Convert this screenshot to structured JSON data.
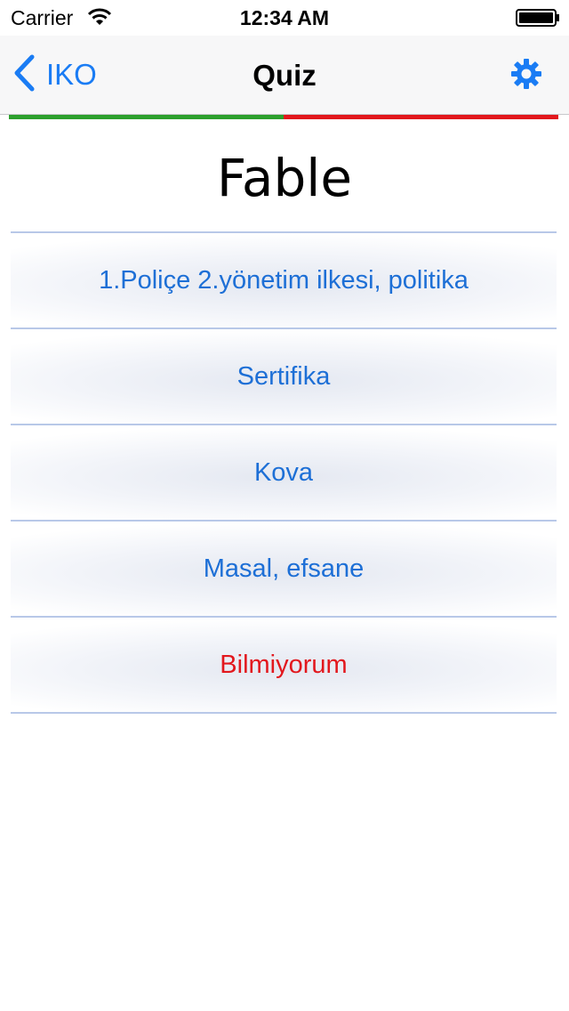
{
  "status_bar": {
    "carrier": "Carrier",
    "time": "12:34 AM",
    "wifi_icon": "wifi-icon",
    "battery_icon": "battery-icon"
  },
  "nav": {
    "back_label": "IKO",
    "title": "Quiz",
    "back_icon": "chevron-left-icon",
    "settings_icon": "gear-icon",
    "accent_color": "#1a7cf4"
  },
  "progress": {
    "correct_fraction": 0.5,
    "correct_color": "#2da02d",
    "wrong_color": "#e2171d"
  },
  "question": {
    "word": "Fable"
  },
  "answers": [
    {
      "label": "1.Poliçe 2.yönetim ilkesi, politika"
    },
    {
      "label": "Sertifika"
    },
    {
      "label": "Kova"
    },
    {
      "label": "Masal, efsane"
    },
    {
      "label": "Bilmiyorum"
    }
  ]
}
